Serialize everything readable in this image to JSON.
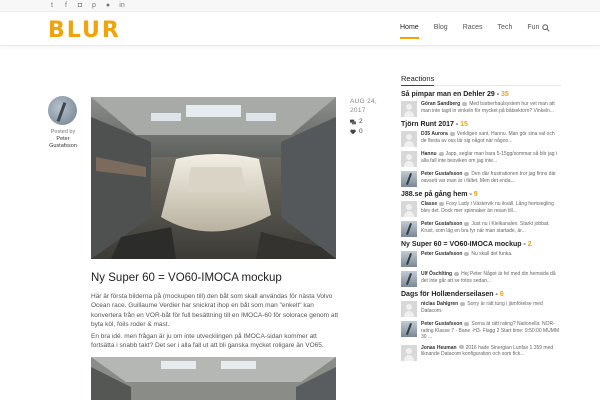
{
  "social_icons": [
    "twitter-icon",
    "facebook-icon",
    "instagram-icon",
    "pinterest-icon",
    "flickr-icon",
    "linkedin-icon"
  ],
  "logo": "BLUR",
  "nav": {
    "items": [
      "Home",
      "Blog",
      "Races",
      "Tech",
      "Fun"
    ],
    "active": "Home"
  },
  "author": {
    "posted_by": "Posted by",
    "name": "Peter Gustafsson"
  },
  "post": {
    "date_line1": "AUG 24,",
    "date_line2": "2017",
    "comments": "2",
    "likes": "0",
    "title": "Ny Super 60 = VO60-IMOCA mockup",
    "paragraph1": "Här är första bilderna på (mockupen till) den båt som skall användas för nästa Volvo Ocean race. Guillaume Verdier har snickrat ihop en båt som man \"enkelt\" kan konvertera från en VOR-båt för full besättning till en IMOCA-60 för solorace genom att byta köl, foils roder & mast.",
    "paragraph2": "En bra idé. men frågan är ju om inte utvecklingen på IMOCA-sidan kommer att fortsätta i snabb takt? Det ser i alla fall ut att bli ganska mycket roligare än VO65."
  },
  "sidebar": {
    "title": "Reactions",
    "topics": [
      {
        "title": "Så pimpar man en Dehler 29 - ",
        "count": "35",
        "comments": [
          {
            "author": "Göran Sandberg",
            "text": "Med barberhaulsystem hur vet man att man inte tagit in vinkeln för mycket på båtsektorn? Vinkeln...",
            "avatar": "blank"
          }
        ]
      },
      {
        "title": "Tjörn Runt 2017 - ",
        "count": "15",
        "comments": [
          {
            "author": "D35 Aurora",
            "text": "Verkligen sant, Hannu. Man gör sina val och de flesta av oss lär sig något när någon...",
            "avatar": "blank"
          },
          {
            "author": "Hannu",
            "text": "Japp, seglar man bara 5-15gg/sommar så blir jag i alla fall inte besviken om jag inte...",
            "avatar": "blank"
          },
          {
            "author": "Peter Gustafsson",
            "text": "Den där frustrationen tror jag finns där oavsett var man är i fältet. Men det enda...",
            "avatar": "photo"
          }
        ]
      },
      {
        "title": "J88.se på gång hem - ",
        "count": "9",
        "comments": [
          {
            "author": "Classe",
            "text": "Foxy Lady i Västervik nu ikväll. Lång hemsegling blev det. Dock mer spinnaker än resan till...",
            "avatar": "blank"
          },
          {
            "author": "Peter Gustafsson",
            "text": "Just nu i Kielkanalen. Starkt jobbat. Kruxt, som läg en bra fyr när man startade, är...",
            "avatar": "photo"
          }
        ]
      },
      {
        "title": "Ny Super 60 = VO60-IMOCA mockup - ",
        "count": "2",
        "comments": [
          {
            "author": "Peter Gustafsson",
            "text": "Nu skall det funka.",
            "avatar": "photo"
          },
          {
            "author": "Ulf Öschlting",
            "text": "Hej Peter Något är fel med din hemsida då det inte går att se fotos sedan...",
            "avatar": "photo"
          }
        ]
      },
      {
        "title": "Dags för Hollænderseilasen - ",
        "count": "6",
        "comments": [
          {
            "author": "niclas Dahlgren",
            "text": "Sorry är rätt tung i jämförelse med Datacom.",
            "avatar": "blank"
          },
          {
            "author": "Peter Gustafsson",
            "text": "Sorna ät rätt rating? Nationella: NOR-rating Klasse 7 - Bane -H3- Flagg 2 Start time: 9:50:00 MUMM 30 ...",
            "avatar": "photo"
          },
          {
            "author": "Jonas Heuman",
            "text": "2016 hade Sinergian Lunfax 1.359 med liknande Datacom konfiguration och som fick...",
            "avatar": "blank"
          }
        ]
      }
    ]
  }
}
